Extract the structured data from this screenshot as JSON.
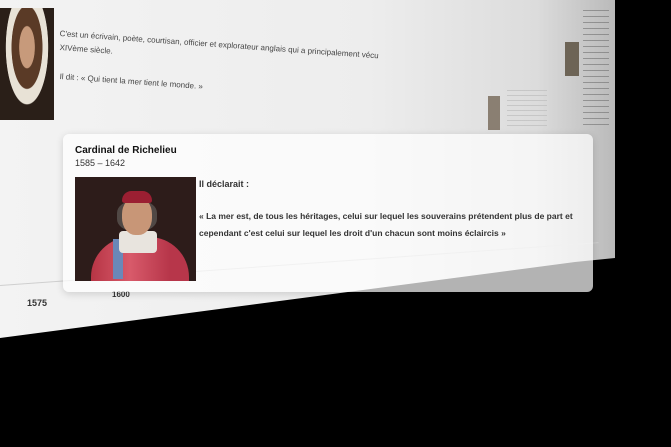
{
  "background_page": {
    "intro_line_1": "C'est un écrivain, poète, courtisan, officier et explorateur anglais qui a principalement vécu",
    "intro_line_2": "XIVème siècle.",
    "quote_line": "Il dit : « Qui tient la mer tient le monde. »",
    "timeline": {
      "label_1575": "1575",
      "label_1600": "1600"
    }
  },
  "card": {
    "name": "Cardinal de Richelieu",
    "dates": "1585 – 1642",
    "quote_intro": "Il déclarait :",
    "quote_text": "« La mer est, de tous les héritages, celui sur lequel les souverains prétendent plus de part et cependant c'est celui sur lequel les droit d'un chacun sont moins éclaircis »",
    "portrait_icon": "portrait-image"
  },
  "colors": {
    "background": "#000000",
    "card_background": "#ffffffb3",
    "text_primary": "#111111",
    "text_secondary": "#333333",
    "robe": "#b73545"
  }
}
